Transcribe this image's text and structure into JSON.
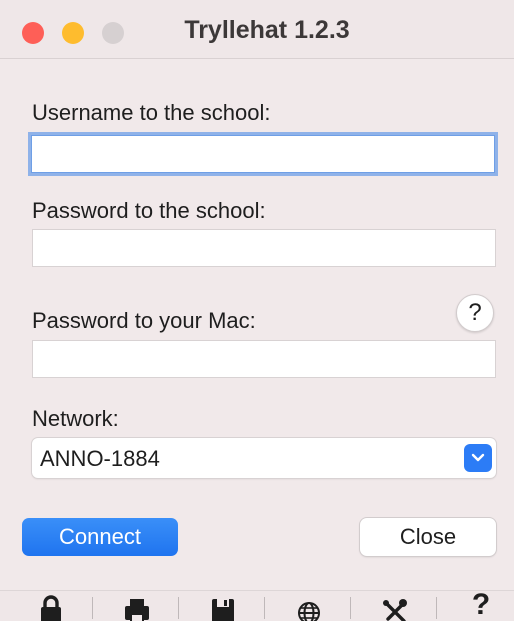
{
  "window": {
    "title": "Tryllehat 1.2.3"
  },
  "form": {
    "username_label": "Username to the school:",
    "username_value": "",
    "school_password_label": "Password to the school:",
    "school_password_value": "",
    "mac_password_label": "Password to your Mac:",
    "mac_password_value": "",
    "help_label": "?",
    "network_label": "Network:",
    "network_value": "ANNO-1884"
  },
  "buttons": {
    "connect": "Connect",
    "close": "Close"
  },
  "toolbar": {
    "icons": [
      "lock-icon",
      "printer-icon",
      "save-icon",
      "globe-icon",
      "tools-icon",
      "help-icon"
    ],
    "help_glyph": "?"
  },
  "colors": {
    "accent": "#2c7cf6",
    "traffic_red": "#fe5f57",
    "traffic_yellow": "#febc2e",
    "traffic_gray": "#d6d0d1",
    "window_bg": "#f1e9ea"
  }
}
